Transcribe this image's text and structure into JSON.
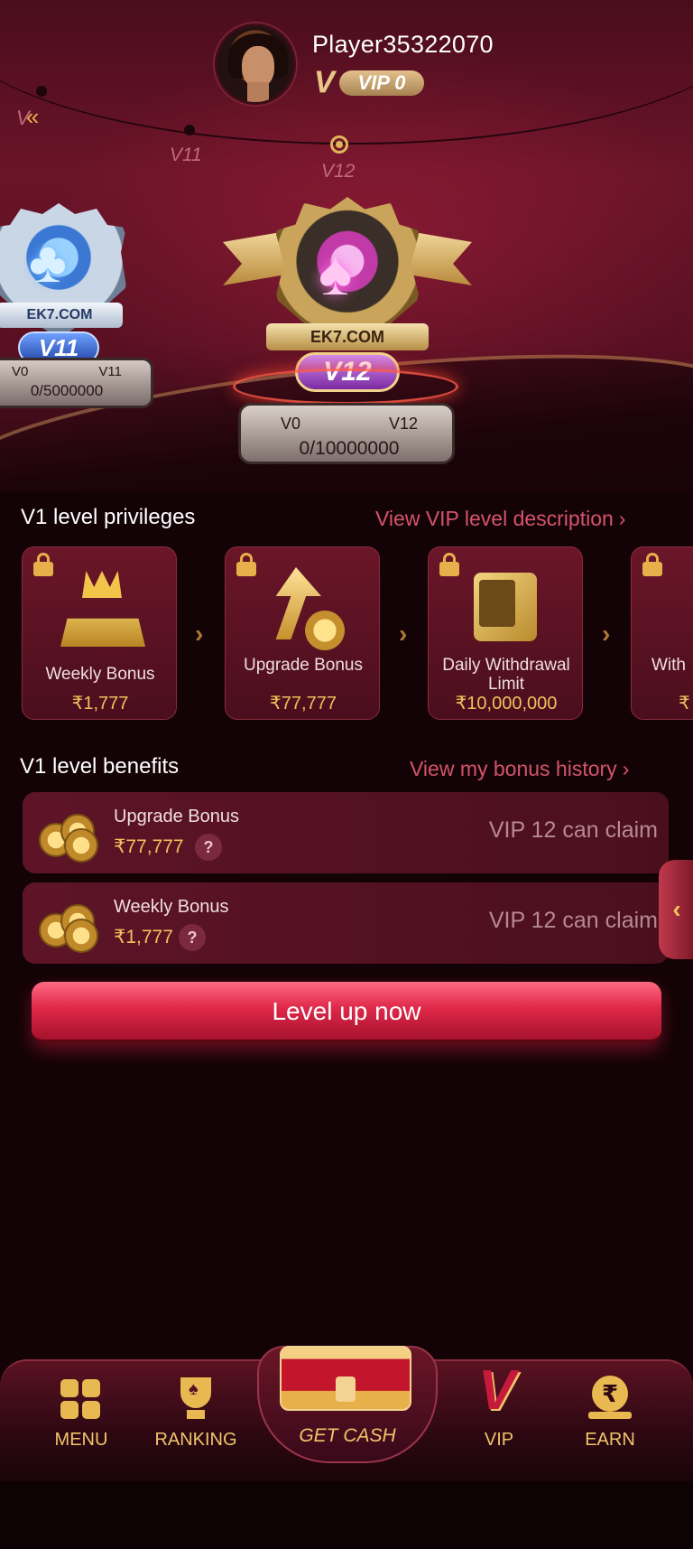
{
  "profile": {
    "name": "Player35322070",
    "vip_level": "VIP 0"
  },
  "level_track": {
    "prev_marker": "V",
    "levels": [
      "V11",
      "V12"
    ],
    "active": "V12"
  },
  "badges": [
    {
      "level": "V11",
      "brand": "EK7.COM",
      "from": "V0",
      "to": "V11",
      "progress": "0/5000000"
    },
    {
      "level": "V12",
      "brand": "EK7.COM",
      "from": "V0",
      "to": "V12",
      "progress": "0/10000000"
    }
  ],
  "privileges": {
    "title": "V1 level privileges",
    "link": "View VIP level description",
    "cards": [
      {
        "label": "Weekly Bonus",
        "value": "₹1,777",
        "locked": true
      },
      {
        "label": "Upgrade Bonus",
        "value": "₹77,777",
        "locked": true
      },
      {
        "label": "Daily Withdrawal Limit",
        "value": "₹10,000,000",
        "locked": true
      },
      {
        "label": "With",
        "value": "₹",
        "locked": true
      }
    ]
  },
  "benefits": {
    "title": "V1 level benefits",
    "link": "View my bonus history",
    "rows": [
      {
        "title": "Upgrade Bonus",
        "amount": "₹77,777",
        "help": "?",
        "status": "VIP 12 can claim"
      },
      {
        "title": "Weekly Bonus",
        "amount": "₹1,777",
        "help": "?",
        "status": "VIP 12 can claim"
      }
    ]
  },
  "cta": {
    "label": "Level up now"
  },
  "side_tab": {
    "glyph": "‹"
  },
  "bottom_nav": {
    "items": [
      {
        "label": "MENU",
        "icon": "menu-grid-icon"
      },
      {
        "label": "RANKING",
        "icon": "trophy-icon"
      },
      {
        "label": "GET CASH",
        "icon": "treasure-chest-icon"
      },
      {
        "label": "VIP",
        "icon": "vip-v-icon"
      },
      {
        "label": "EARN",
        "icon": "rupee-coin-icon"
      }
    ]
  },
  "colors": {
    "accent_gold": "#f1c46a",
    "link_red": "#d4546c",
    "button_red": "#e0284a",
    "background": "#140306"
  }
}
